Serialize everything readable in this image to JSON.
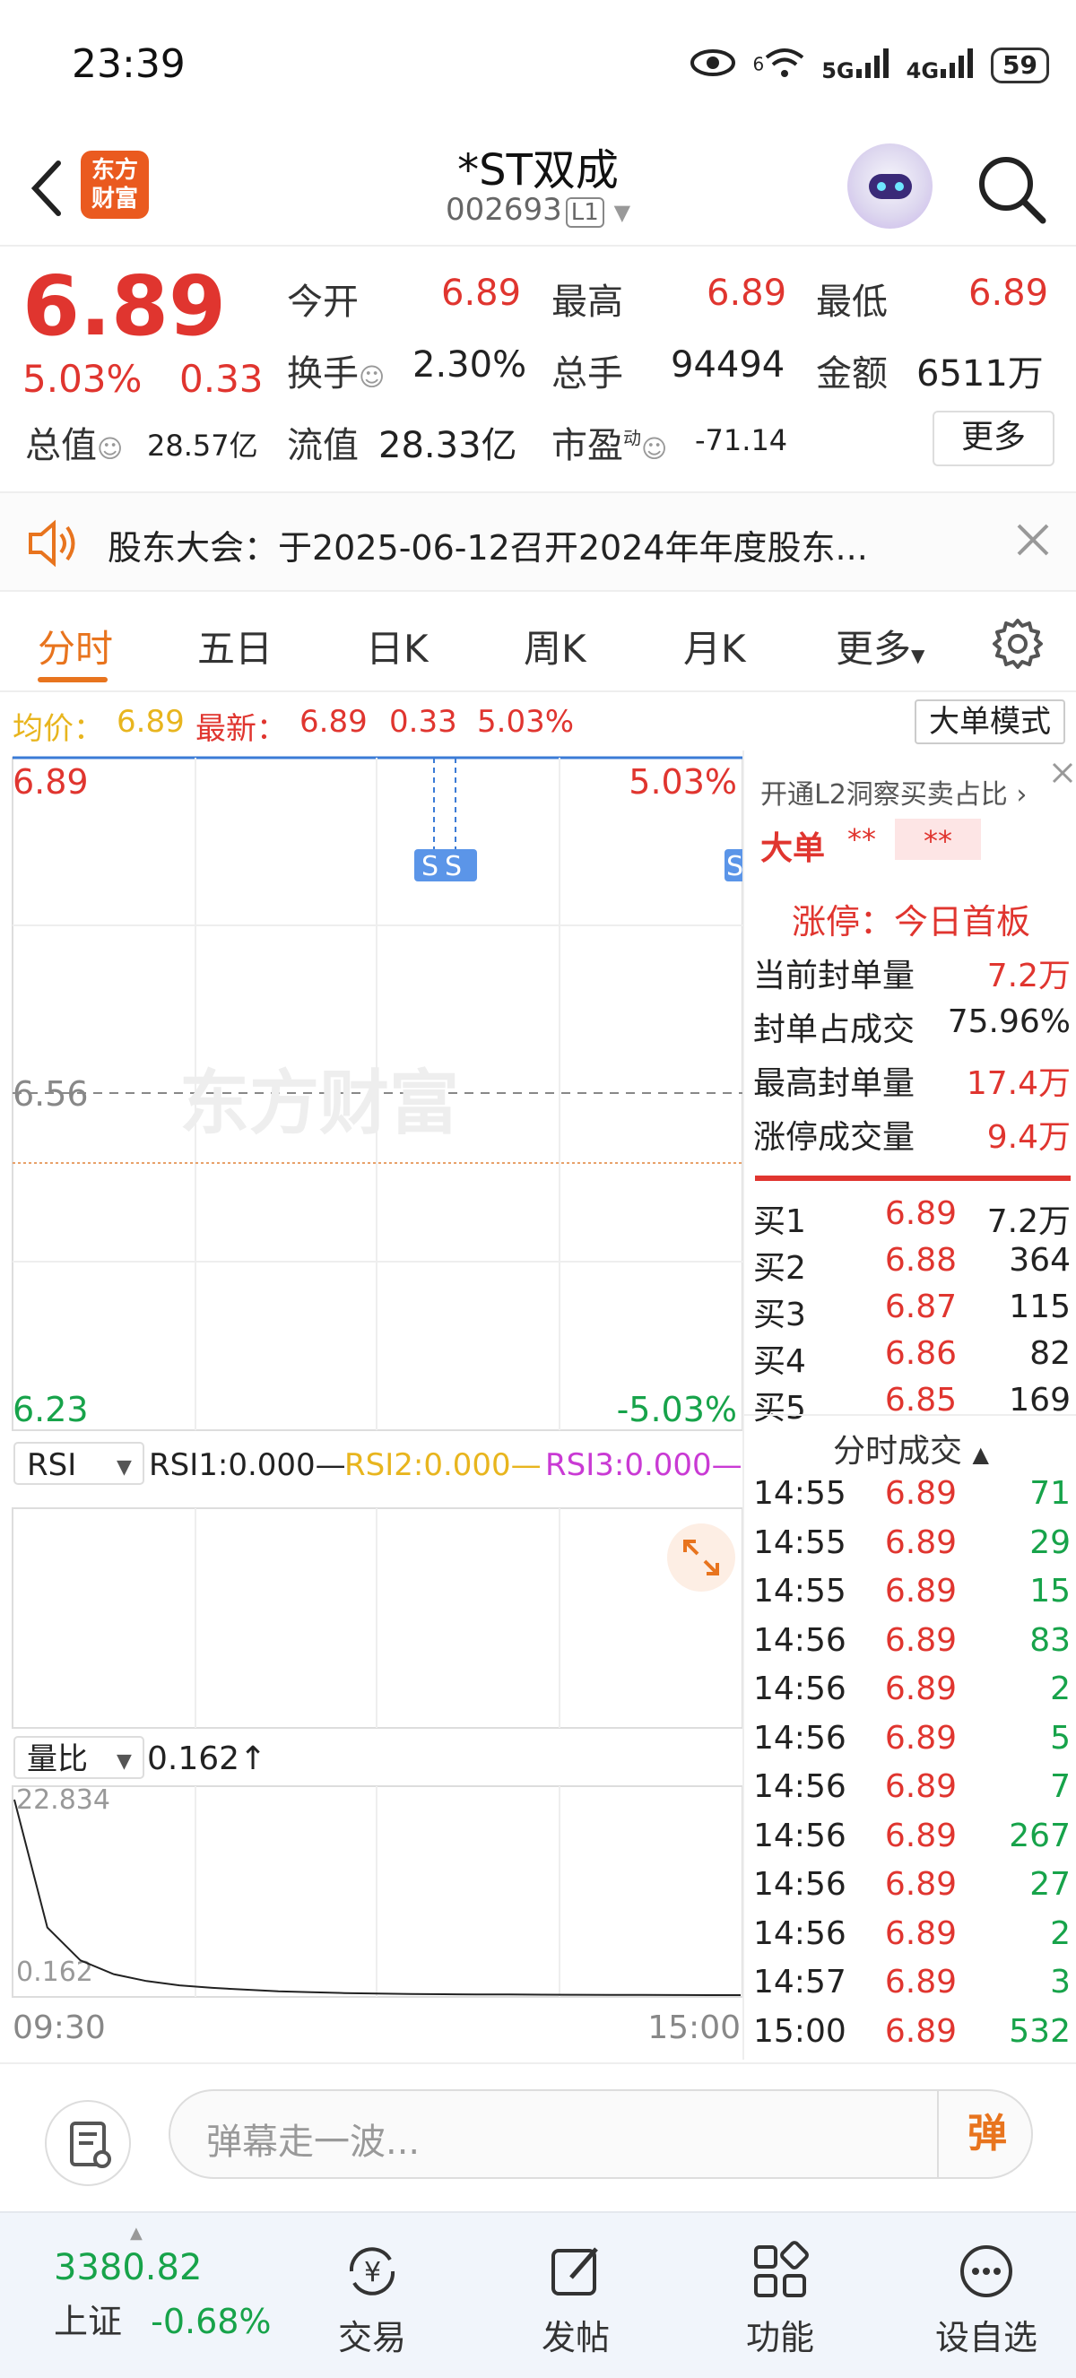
{
  "status": {
    "time": "23:39",
    "battery": "59",
    "net1": "6",
    "net2": "5G",
    "net3": "4G"
  },
  "header": {
    "name": "*ST双成",
    "code": "002693",
    "level": "L1",
    "logo_text": "东方财富"
  },
  "quote": {
    "price": "6.89",
    "pct": "5.03%",
    "chg": "0.33",
    "open_label": "今开",
    "open": "6.89",
    "high_label": "最高",
    "high": "6.89",
    "low_label": "最低",
    "low": "6.89",
    "turnover_label": "换手",
    "turnover": "2.30%",
    "volume_label": "总手",
    "volume": "94494",
    "amount_label": "金额",
    "amount": "6511万",
    "mktcap_label": "总值",
    "mktcap": "28.57亿",
    "float_label": "流值",
    "float": "28.33亿",
    "pe_label": "市盈",
    "pe_sup": "动",
    "pe": "-71.14",
    "more": "更多"
  },
  "notice": {
    "text": "股东大会：于2025-06-12召开2024年年度股东..."
  },
  "tabs": [
    "分时",
    "五日",
    "日K",
    "周K",
    "月K",
    "更多"
  ],
  "avgline": {
    "avg_label": "均价：",
    "avg": "6.89",
    "latest_label": "最新：",
    "latest": "6.89",
    "chg": "0.33",
    "pct": "5.03%",
    "bigorder": "大单模式"
  },
  "chart": {
    "top_price": "6.89",
    "top_pct": "5.03%",
    "mid_price": "6.56",
    "bottom_price": "6.23",
    "bottom_pct": "-5.03%",
    "watermark": "东方财富",
    "s_markers": [
      "S",
      "S",
      "S"
    ],
    "rsi_select": "RSI",
    "rsi1": "RSI1:0.000—",
    "rsi2": "RSI2:0.000—",
    "rsi3": "RSI3:0.000—",
    "vr_select": "量比",
    "vr_value": "0.162↑",
    "vr_top": "22.834",
    "vr_bottom": "0.162",
    "time_start": "09:30",
    "time_end": "15:00",
    "colors": {
      "up": "#e0352f",
      "down": "#17a34a",
      "avg": "#e8b51e",
      "rsi3": "#c93ad4"
    }
  },
  "chart_data": {
    "type": "line",
    "x": [
      "09:30",
      "15:00"
    ],
    "series": [],
    "ylim": [
      6.23,
      6.89
    ],
    "vr_ylim": [
      0.162,
      22.834
    ],
    "vr_series": [
      22.834,
      8.0,
      4.2,
      2.6,
      1.8,
      1.3,
      1.0,
      0.8,
      0.6,
      0.5,
      0.4,
      0.35,
      0.3,
      0.27,
      0.25,
      0.23,
      0.21,
      0.2,
      0.19,
      0.18,
      0.17,
      0.165,
      0.162
    ]
  },
  "panel": {
    "l2_text": "开通L2洞察买卖占比",
    "big_label": "大单",
    "big_v1": "**",
    "big_v2": "**",
    "limit_title": "涨停：今日首板",
    "rows": [
      {
        "label": "当前封单量",
        "value": "7.2万"
      },
      {
        "label": "封单占成交",
        "value": "75.96%"
      },
      {
        "label": "最高封单量",
        "value": "17.4万"
      },
      {
        "label": "涨停成交量",
        "value": "9.4万"
      }
    ],
    "bids": [
      {
        "label": "买1",
        "price": "6.89",
        "vol": "7.2万"
      },
      {
        "label": "买2",
        "price": "6.88",
        "vol": "364"
      },
      {
        "label": "买3",
        "price": "6.87",
        "vol": "115"
      },
      {
        "label": "买4",
        "price": "6.86",
        "vol": "82"
      },
      {
        "label": "买5",
        "price": "6.85",
        "vol": "169"
      }
    ],
    "trades_title": "分时成交",
    "trades": [
      {
        "t": "14:55",
        "p": "6.89",
        "v": "71"
      },
      {
        "t": "14:55",
        "p": "6.89",
        "v": "29"
      },
      {
        "t": "14:55",
        "p": "6.89",
        "v": "15"
      },
      {
        "t": "14:56",
        "p": "6.89",
        "v": "83"
      },
      {
        "t": "14:56",
        "p": "6.89",
        "v": "2"
      },
      {
        "t": "14:56",
        "p": "6.89",
        "v": "5"
      },
      {
        "t": "14:56",
        "p": "6.89",
        "v": "7"
      },
      {
        "t": "14:56",
        "p": "6.89",
        "v": "267"
      },
      {
        "t": "14:56",
        "p": "6.89",
        "v": "27"
      },
      {
        "t": "14:56",
        "p": "6.89",
        "v": "2"
      },
      {
        "t": "14:57",
        "p": "6.89",
        "v": "3"
      },
      {
        "t": "15:00",
        "p": "6.89",
        "v": "532"
      }
    ]
  },
  "barrage": {
    "placeholder": "弹幕走一波...",
    "btn": "弹"
  },
  "nav": {
    "index_value": "3380.82",
    "index_name": "上证",
    "index_pct": "-0.68%",
    "items": [
      "交易",
      "发帖",
      "功能",
      "设自选"
    ]
  }
}
